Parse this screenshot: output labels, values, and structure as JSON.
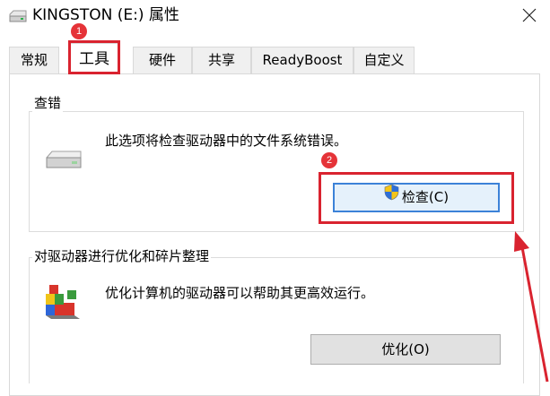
{
  "window": {
    "title": "KINGSTON (E:) 属性",
    "title_icon": "drive-icon",
    "close_icon": "close-icon"
  },
  "tabs": [
    {
      "label": "常规",
      "active": false
    },
    {
      "label": "工具",
      "active": true
    },
    {
      "label": "硬件",
      "active": false
    },
    {
      "label": "共享",
      "active": false
    },
    {
      "label": "ReadyBoost",
      "active": false
    },
    {
      "label": "自定义",
      "active": false
    }
  ],
  "annotations": {
    "step1": "1",
    "step2": "2",
    "color": "#d9232f"
  },
  "error_check": {
    "group_title": "查错",
    "icon": "hard-drive-icon",
    "description": "此选项将检查驱动器中的文件系统错误。",
    "button_label": "检查(C)",
    "button_icon": "uac-shield-icon"
  },
  "optimize": {
    "group_title": "对驱动器进行优化和碎片整理",
    "icon": "defrag-icon",
    "description": "优化计算机的驱动器可以帮助其更高效运行。",
    "button_label": "优化(O)"
  }
}
